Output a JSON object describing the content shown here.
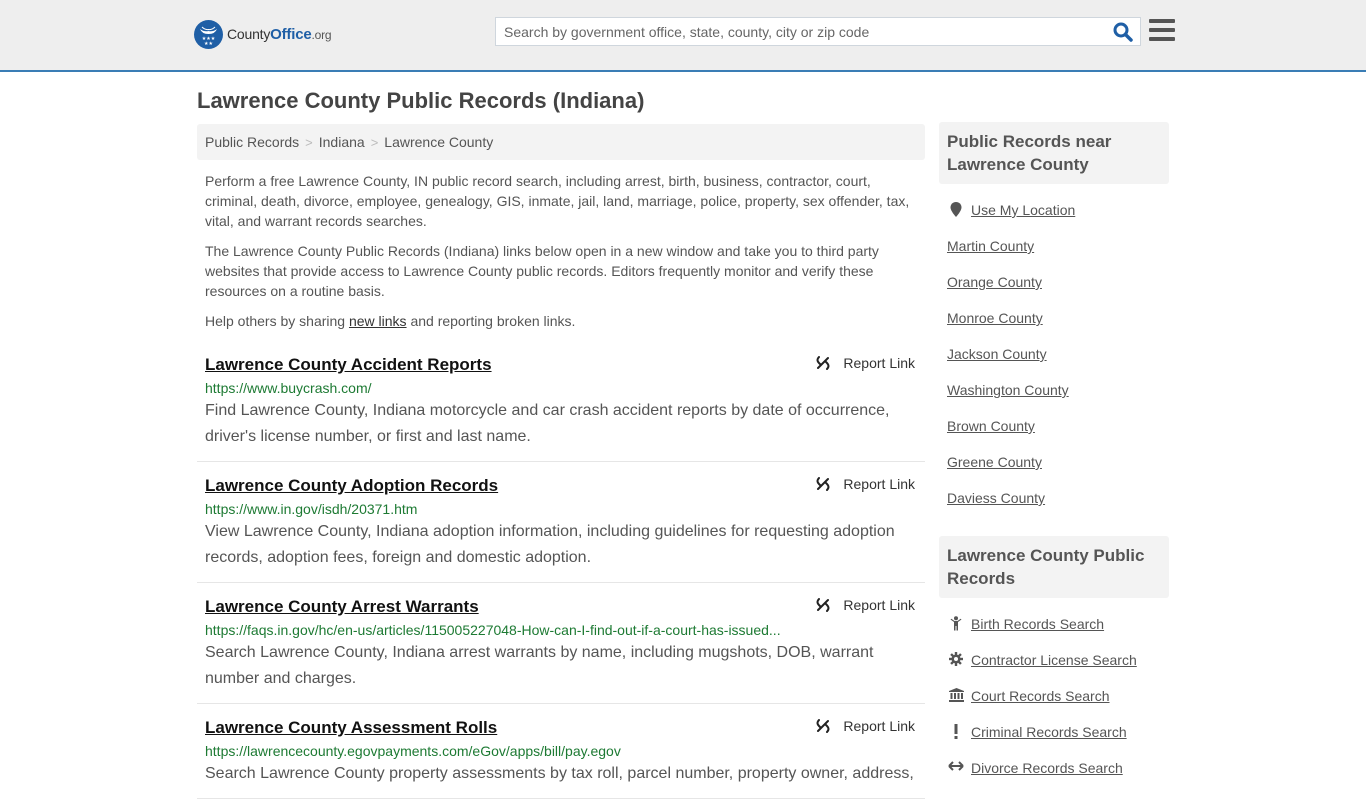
{
  "header": {
    "logo": {
      "brand_main": "County",
      "brand_accent": "Office",
      "brand_tld": ".org"
    },
    "search": {
      "placeholder": "Search by government office, state, county, city or zip code",
      "value": ""
    },
    "search_icon": "search-icon",
    "menu_icon": "hamburger-menu-icon"
  },
  "page": {
    "title": "Lawrence County Public Records (Indiana)"
  },
  "breadcrumb": [
    {
      "label": "Public Records"
    },
    {
      "label": "Indiana"
    },
    {
      "label": "Lawrence County"
    }
  ],
  "breadcrumb_separator": ">",
  "intro": {
    "p1": "Perform a free Lawrence County, IN public record search, including arrest, birth, business, contractor, court, criminal, death, divorce, employee, genealogy, GIS, inmate, jail, land, marriage, police, property, sex offender, tax, vital, and warrant records searches.",
    "p2": "The Lawrence County Public Records (Indiana) links below open in a new window and take you to third party websites that provide access to Lawrence County public records. Editors frequently monitor and verify these resources on a routine basis.",
    "p3_before": "Help others by sharing ",
    "p3_link": "new links",
    "p3_after": " and reporting broken links."
  },
  "records": [
    {
      "title": "Lawrence County Accident Reports",
      "url": "https://www.buycrash.com/",
      "description": "Find Lawrence County, Indiana motorcycle and car crash accident reports by date of occurrence, driver's license number, or first and last name.",
      "report_label": "Report Link"
    },
    {
      "title": "Lawrence County Adoption Records",
      "url": "https://www.in.gov/isdh/20371.htm",
      "description": "View Lawrence County, Indiana adoption information, including guidelines for requesting adoption records, adoption fees, foreign and domestic adoption.",
      "report_label": "Report Link"
    },
    {
      "title": "Lawrence County Arrest Warrants",
      "url": "https://faqs.in.gov/hc/en-us/articles/115005227048-How-can-I-find-out-if-a-court-has-issued...",
      "description": "Search Lawrence County, Indiana arrest warrants by name, including mugshots, DOB, warrant number and charges.",
      "report_label": "Report Link"
    },
    {
      "title": "Lawrence County Assessment Rolls",
      "url": "https://lawrencecounty.egovpayments.com/eGov/apps/bill/pay.egov",
      "description": "Search Lawrence County property assessments by tax roll, parcel number, property owner, address,",
      "report_label": "Report Link"
    }
  ],
  "sidebar": {
    "nearby": {
      "heading": "Public Records near Lawrence County",
      "use_location": "Use My Location",
      "counties": [
        "Martin County",
        "Orange County",
        "Monroe County",
        "Jackson County",
        "Washington County",
        "Brown County",
        "Greene County",
        "Daviess County"
      ]
    },
    "county_records": {
      "heading": "Lawrence County Public Records",
      "items": [
        {
          "label": "Birth Records Search",
          "icon": "child-icon"
        },
        {
          "label": "Contractor License Search",
          "icon": "gear-icon"
        },
        {
          "label": "Court Records Search",
          "icon": "courthouse-icon"
        },
        {
          "label": "Criminal Records Search",
          "icon": "exclamation-icon"
        },
        {
          "label": "Divorce Records Search",
          "icon": "arrows-horizontal-icon"
        }
      ]
    }
  },
  "colors": {
    "header_bg": "#eeeeee",
    "header_border": "#3a7db5",
    "brand_blue": "#1f5fa6",
    "url_green": "#1d7a33",
    "title_text": "#444444",
    "panel_bg": "#f3f3f3"
  }
}
